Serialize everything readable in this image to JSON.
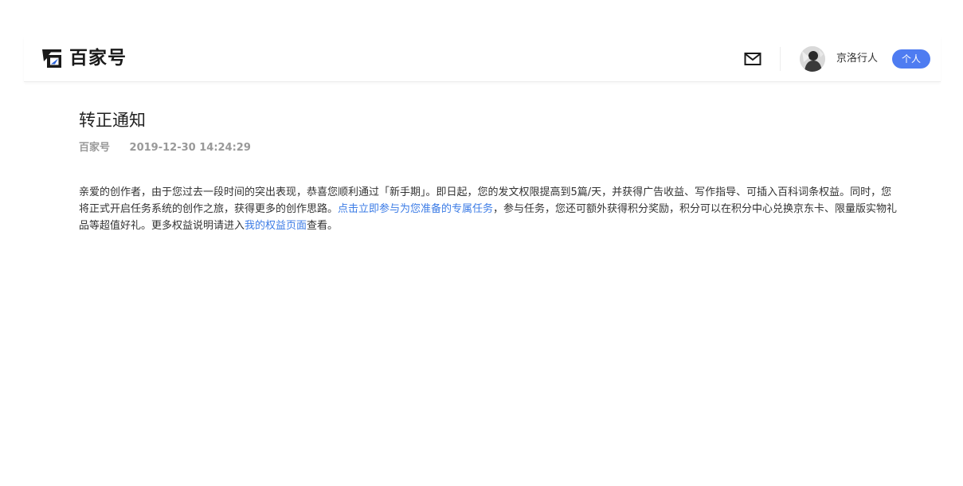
{
  "header": {
    "logo_text": "百家号",
    "username": "京洛行人",
    "account_type_badge": "个人"
  },
  "notice": {
    "title": "转正通知",
    "source": "百家号",
    "datetime": "2019-12-30 14:24:29",
    "body_part1": "亲爱的创作者，由于您过去一段时间的突出表现，恭喜您顺利通过「新手期」。即日起，您的发文权限提高到5篇/天，并获得广告收益、写作指导、可插入百科词条权益。同时，您将正式开启任务系统的创作之旅，获得更多的创作思路。",
    "link_tasks": "点击立即参与为您准备的专属任务",
    "body_part2": "，参与任务，您还可额外获得积分奖励，积分可以在积分中心兑换京东卡、限量版实物礼品等超值好礼。更多权益说明请进入",
    "link_rights": "我的权益页面",
    "body_part3": "查看。"
  },
  "icons": {
    "logo": "baijiahao-logo-icon",
    "mail": "mail-icon",
    "avatar": "user-avatar"
  },
  "colors": {
    "accent": "#4e7cf1",
    "link": "#3c7ce6",
    "meta_text": "#999999"
  }
}
